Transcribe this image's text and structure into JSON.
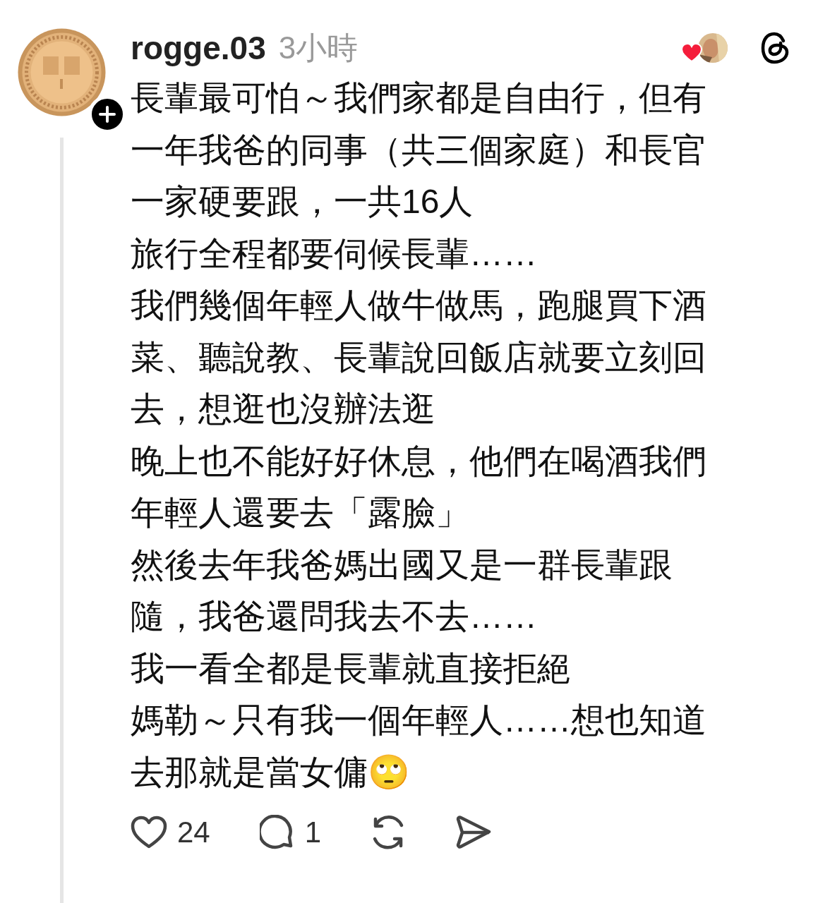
{
  "post": {
    "author": "rogge.03",
    "time": "3小時",
    "followable": true,
    "liked_by_author": true,
    "lines": [
      "長輩最可怕～我們家都是自由行，但有",
      "一年我爸的同事（共三個家庭）和長官",
      "一家硬要跟，一共16人",
      "旅行全程都要伺候長輩……",
      "我們幾個年輕人做牛做馬，跑腿買下酒",
      "菜、聽說教、長輩說回飯店就要立刻回",
      "去，想逛也沒辦法逛",
      "晚上也不能好好休息，他們在喝酒我們",
      "年輕人還要去「露臉」",
      "然後去年我爸媽出國又是一群長輩跟",
      "隨，我爸還問我去不去……",
      "我一看全都是長輩就直接拒絕",
      "媽勒～只有我一個年輕人……想也知道",
      "去那就是當女傭🙄"
    ],
    "actions": [
      {
        "kind": "like",
        "count": "24"
      },
      {
        "kind": "reply",
        "count": "1"
      },
      {
        "kind": "repost"
      },
      {
        "kind": "share"
      }
    ]
  }
}
